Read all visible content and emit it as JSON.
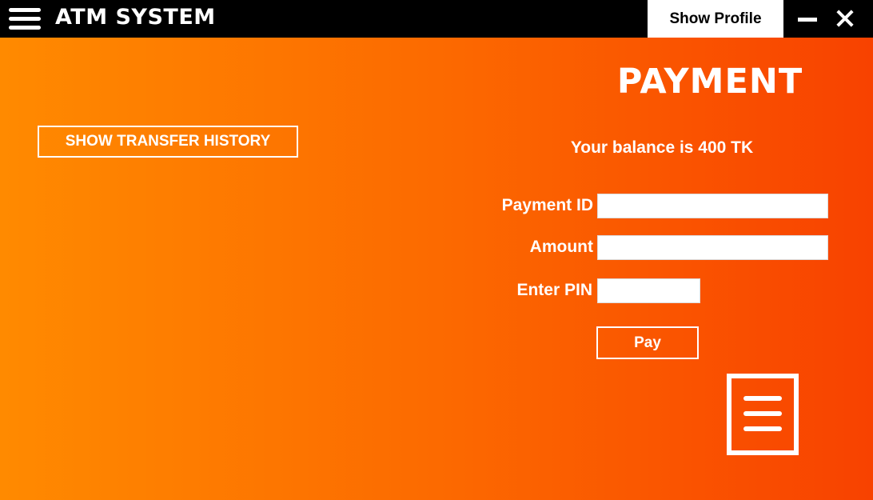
{
  "titlebar": {
    "app_title": "ATM SYSTEM",
    "profile_button": "Show Profile",
    "menu_icon": "hamburger-menu-icon",
    "minimize_icon": "minimize-icon",
    "close_icon": "close-icon"
  },
  "page": {
    "title": "PAYMENT",
    "history_button": "SHOW TRANSFER HISTORY",
    "balance_text": "Your balance is 400 TK",
    "receipt_icon": "receipt-icon"
  },
  "form": {
    "payment_id": {
      "label": "Payment ID",
      "value": ""
    },
    "amount": {
      "label": "Amount",
      "value": ""
    },
    "pin": {
      "label": "Enter PIN",
      "value": ""
    },
    "pay_button": "Pay"
  },
  "colors": {
    "titlebar_bg": "#000000",
    "gradient_start": "#ff8a00",
    "gradient_end": "#f84200",
    "text": "#ffffff"
  }
}
